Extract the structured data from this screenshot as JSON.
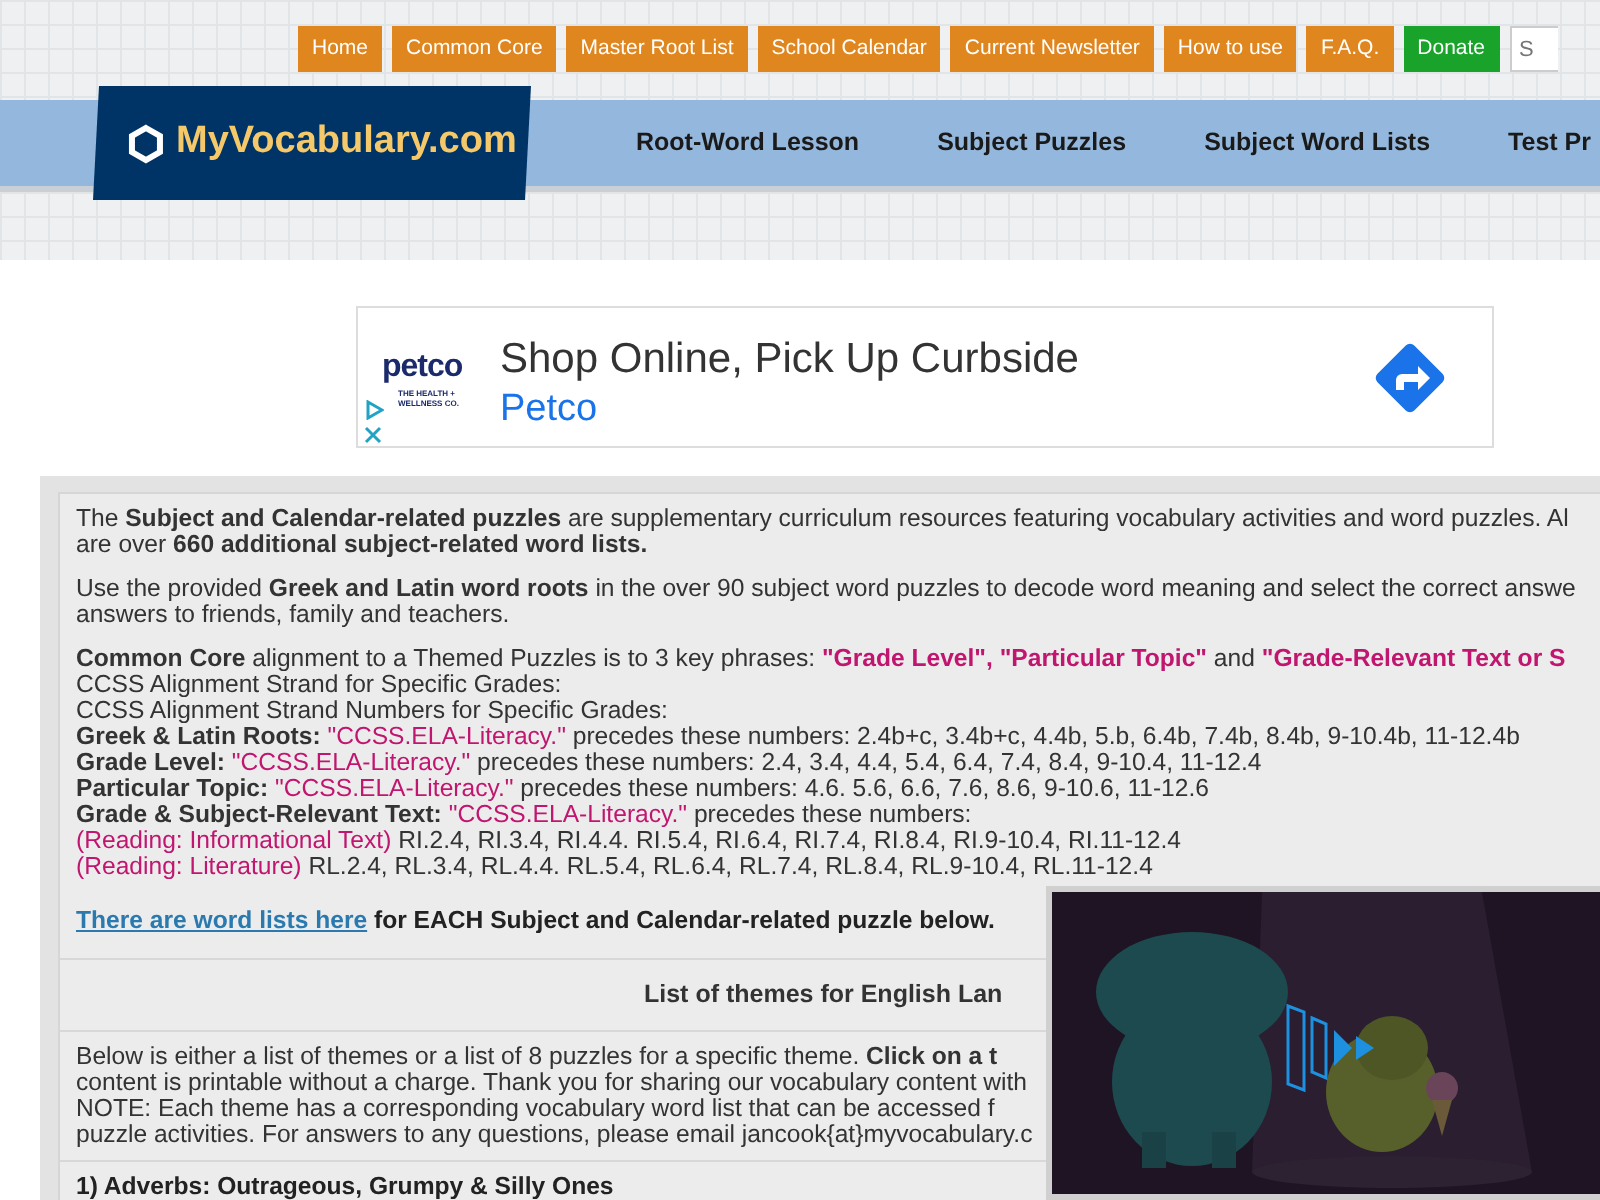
{
  "top_nav": [
    {
      "label": "Home",
      "kind": "link"
    },
    {
      "label": "Common Core",
      "kind": "link"
    },
    {
      "label": "Master Root List",
      "kind": "link"
    },
    {
      "label": "School Calendar",
      "kind": "link"
    },
    {
      "label": "Current Newsletter",
      "kind": "link"
    },
    {
      "label": "How to use",
      "kind": "link"
    },
    {
      "label": "F.A.Q.",
      "kind": "link"
    },
    {
      "label": "Donate",
      "kind": "donate"
    }
  ],
  "search": {
    "placeholder": "S"
  },
  "logo": {
    "text": "MyVocabulary.com"
  },
  "main_nav": [
    "Root-Word Lesson",
    "Subject Puzzles",
    "Subject Word Lists",
    "Test Pr"
  ],
  "ad": {
    "brand": "petco",
    "tagline": "THE HEALTH + WELLNESS CO.",
    "headline": "Shop Online, Pick Up Curbside",
    "advertiser": "Petco"
  },
  "intro": [
    {
      "lines": [
        [
          {
            "text": "The **Subject and Calendar-related puzzles** are supplementary curriculum resources featuring vocabulary activities and word puzzles. Al",
            "kind": "text"
          }
        ],
        [
          {
            "text": "are over **660 additional subject-related word lists.**",
            "kind": "text"
          }
        ]
      ]
    },
    {
      "lines": [
        [
          {
            "text": "Use the provided **Greek and Latin word roots** in the over 90 subject word puzzles to decode word meaning and select the correct answe",
            "kind": "text"
          }
        ],
        [
          {
            "text": "answers to friends, family and teachers.",
            "kind": "text"
          }
        ]
      ]
    },
    {
      "lines": [
        [
          {
            "text": "**Common Core** alignment to a Themed Puzzles is to 3 key phrases: ",
            "kind": "text"
          },
          {
            "text": "\"Grade Level\", \"Particular Topic\"",
            "kind": "phrase"
          },
          {
            "text": " and ",
            "kind": "text"
          },
          {
            "text": "\"Grade-Relevant Text or S",
            "kind": "phrase"
          }
        ],
        [
          {
            "text": "CCSS Alignment Strand for Specific Grades:",
            "kind": "text"
          }
        ],
        [
          {
            "text": "CCSS Alignment Strand Numbers for Specific Grades:",
            "kind": "text"
          }
        ],
        [
          {
            "text": "**Greek & Latin Roots:** ",
            "kind": "text"
          },
          {
            "text": "\"CCSS.ELA-Literacy.\"",
            "kind": "code"
          },
          {
            "text": " precedes these numbers: 2.4b+c, 3.4b+c, 4.4b, 5.b, 6.4b, 7.4b, 8.4b, 9-10.4b, 11-12.4b",
            "kind": "text"
          }
        ],
        [
          {
            "text": "**Grade Level:** ",
            "kind": "text"
          },
          {
            "text": "\"CCSS.ELA-Literacy.\"",
            "kind": "code"
          },
          {
            "text": " precedes these numbers: 2.4, 3.4, 4.4, 5.4, 6.4, 7.4, 8.4, 9-10.4, 11-12.4",
            "kind": "text"
          }
        ],
        [
          {
            "text": "**Particular Topic:** ",
            "kind": "text"
          },
          {
            "text": "\"CCSS.ELA-Literacy.\"",
            "kind": "code"
          },
          {
            "text": " precedes these numbers: 4.6. 5.6, 6.6, 7.6, 8.6, 9-10.6, 11-12.6",
            "kind": "text"
          }
        ],
        [
          {
            "text": "**Grade & Subject-Relevant Text:** ",
            "kind": "text"
          },
          {
            "text": "\"CCSS.ELA-Literacy.\"",
            "kind": "code"
          },
          {
            "text": " precedes these numbers:",
            "kind": "text"
          }
        ],
        [
          {
            "text": "(Reading: Informational Text)",
            "kind": "code"
          },
          {
            "text": " RI.2.4, RI.3.4, RI.4.4. RI.5.4, RI.6.4, RI.7.4, RI.8.4, RI.9-10.4, RI.11-12.4",
            "kind": "text"
          }
        ],
        [
          {
            "text": "(Reading: Literature)",
            "kind": "code"
          },
          {
            "text": " RL.2.4, RL.3.4, RL.4.4. RL.5.4, RL.6.4, RL.7.4, RL.8.4, RL.9-10.4, RL.11-12.4",
            "kind": "text"
          }
        ]
      ]
    }
  ],
  "word_list_note": [
    {
      "text": "There are word lists here",
      "kind": "link"
    },
    {
      "text": " for EACH Subject and Calendar-related puzzle below.",
      "kind": "note"
    }
  ],
  "themes_heading": "List of themes for English Lan",
  "themes_intro": [
    [
      {
        "text": "Below is either a list of themes or a list of 8 puzzles for a specific theme. **Click on a t**",
        "kind": "text"
      }
    ],
    [
      {
        "text": "content is printable without a charge. Thank you for sharing our vocabulary content with",
        "kind": "text"
      }
    ],
    [
      {
        "text": "NOTE: Each theme has a corresponding vocabulary word list that can be accessed f",
        "kind": "text"
      }
    ],
    [
      {
        "text": "puzzle activities. For answers to any questions, please email jancook{at}myvocabulary.c",
        "kind": "text"
      }
    ]
  ],
  "themes": [
    "1) Adverbs: Outrageous, Grumpy & Silly Ones"
  ]
}
